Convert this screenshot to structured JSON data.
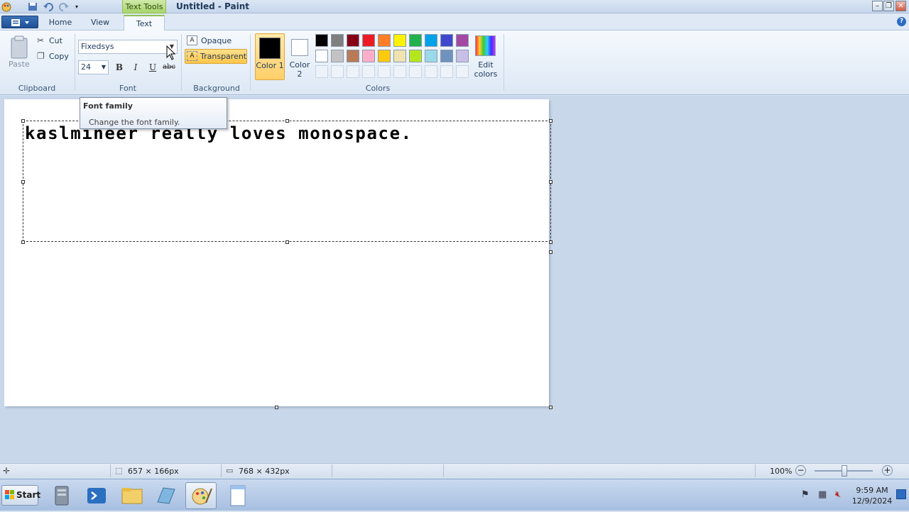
{
  "window": {
    "title": "Untitled - Paint",
    "context_tab": "Text Tools"
  },
  "tabs": [
    "Home",
    "View",
    "Text"
  ],
  "clipboard": {
    "paste": "Paste",
    "cut": "Cut",
    "copy": "Copy",
    "label": "Clipboard"
  },
  "font": {
    "family": "Fixedsys",
    "size": "24",
    "label": "Font",
    "bold": "B",
    "italic": "I",
    "underline": "U",
    "strike": "abc"
  },
  "background": {
    "opaque": "Opaque",
    "transparent": "Transparent",
    "label": "Background"
  },
  "colors": {
    "color1": "Color 1",
    "color2": "Color 2",
    "edit": "Edit colors",
    "label": "Colors",
    "color1_value": "#000000",
    "color2_value": "#ffffff",
    "palette_row1": [
      "#000000",
      "#7f7f7f",
      "#880015",
      "#ed1c24",
      "#ff7f27",
      "#fff200",
      "#22b14c",
      "#00a2e8",
      "#3f48cc",
      "#a349a4"
    ],
    "palette_row2": [
      "#ffffff",
      "#c3c3c3",
      "#b97a57",
      "#ffaec9",
      "#ffc90e",
      "#efe4b0",
      "#b5e61d",
      "#99d9ea",
      "#7092be",
      "#c8bfe7"
    ]
  },
  "tooltip": {
    "title": "Font family",
    "body": "Change the font family."
  },
  "canvas": {
    "text": "kaslmineer really loves monospace."
  },
  "status": {
    "selection_size": "657 × 166px",
    "canvas_size": "768 × 432px",
    "zoom": "100%"
  },
  "taskbar": {
    "start": "Start",
    "time": "9:59 AM",
    "date": "12/9/2024"
  }
}
